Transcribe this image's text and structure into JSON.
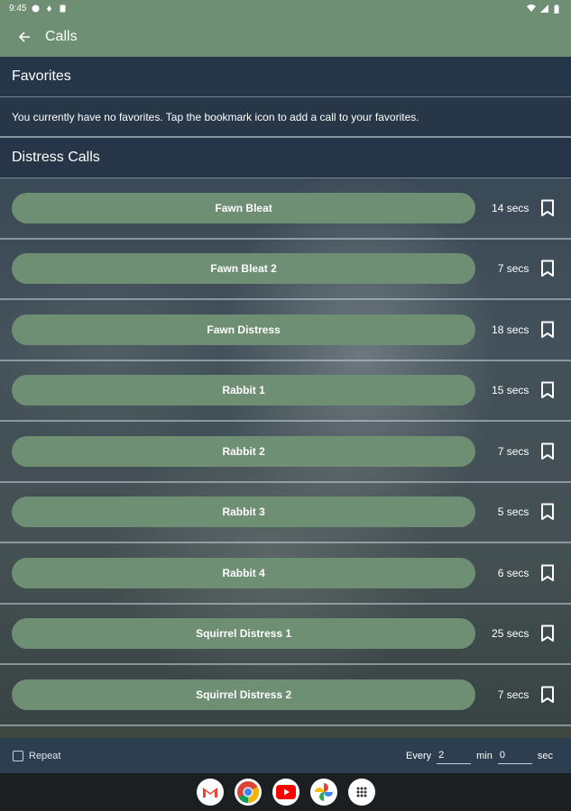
{
  "status_bar": {
    "time": "9:45"
  },
  "app_bar": {
    "title": "Calls"
  },
  "favorites": {
    "title": "Favorites",
    "message": "You currently have no favorites. Tap the bookmark icon to add a call to your favorites."
  },
  "distress": {
    "title": "Distress Calls",
    "calls": [
      {
        "label": "Fawn Bleat",
        "duration": "14 secs"
      },
      {
        "label": "Fawn Bleat 2",
        "duration": "7 secs"
      },
      {
        "label": "Fawn Distress",
        "duration": "18 secs"
      },
      {
        "label": "Rabbit 1",
        "duration": "15 secs"
      },
      {
        "label": "Rabbit 2",
        "duration": "7 secs"
      },
      {
        "label": "Rabbit 3",
        "duration": "5 secs"
      },
      {
        "label": "Rabbit 4",
        "duration": "6 secs"
      },
      {
        "label": "Squirrel Distress 1",
        "duration": "25 secs"
      },
      {
        "label": "Squirrel Distress 2",
        "duration": "7 secs"
      }
    ]
  },
  "repeat_bar": {
    "repeat_label": "Repeat",
    "every_label": "Every",
    "min_value": "2",
    "min_label": "min",
    "sec_value": "0",
    "sec_label": "sec"
  },
  "dock": [
    "gmail-icon",
    "chrome-icon",
    "youtube-icon",
    "photos-icon",
    "apps-icon"
  ],
  "colors": {
    "accent": "#6e8f73",
    "header_bg": "#243446",
    "nav_bg": "#1b1f22"
  }
}
